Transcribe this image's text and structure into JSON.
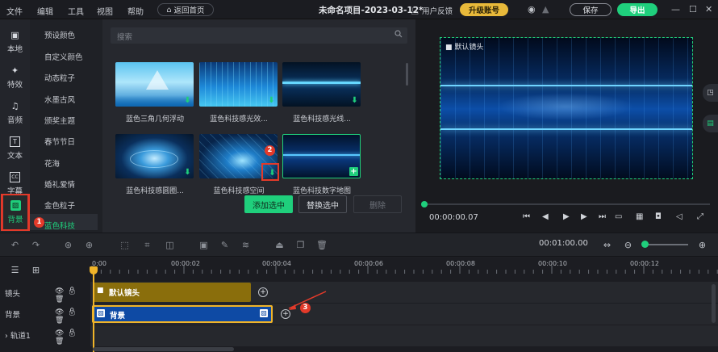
{
  "menu": [
    "文件",
    "编辑",
    "工具",
    "视图",
    "帮助"
  ],
  "home_button": "返回首页",
  "project_title": "未命名项目-2023-03-12*",
  "feedback": "用户反馈",
  "upgrade": "升级账号",
  "save": "保存",
  "export": "导出",
  "rail": [
    {
      "label": "本地",
      "icon": "folder-icon"
    },
    {
      "label": "特效",
      "icon": "effects-icon"
    },
    {
      "label": "音频",
      "icon": "music-icon"
    },
    {
      "label": "文本",
      "icon": "text-icon"
    },
    {
      "label": "字幕",
      "icon": "subtitle-icon"
    },
    {
      "label": "背景",
      "icon": "background-icon"
    }
  ],
  "categories": [
    "预设颜色",
    "自定义颜色",
    "动态粒子",
    "水墨古风",
    "颁奖主题",
    "春节节日",
    "花海",
    "婚礼爱情",
    "金色粒子",
    "蓝色科技"
  ],
  "search_placeholder": "搜索",
  "thumbnails": [
    {
      "label": "蓝色三角几何浮动"
    },
    {
      "label": "蓝色科技感光效..."
    },
    {
      "label": "蓝色科技感光线..."
    },
    {
      "label": "蓝色科技感圆圈..."
    },
    {
      "label": "蓝色科技感空间"
    },
    {
      "label": "蓝色科技数字地图"
    }
  ],
  "buttons": {
    "add": "添加选中",
    "replace": "替换选中",
    "delete": "删除"
  },
  "preview": {
    "label": "默认镜头",
    "timecode": "00:00:00.07",
    "progress": 0.0
  },
  "toolbar": {
    "duration": "00:01:00.00"
  },
  "ruler": [
    "0:00",
    "00:00:02",
    "00:00:04",
    "00:00:06",
    "00:00:08",
    "00:00:10",
    "00:00:12"
  ],
  "tracks": [
    {
      "name": "镜头",
      "clip": "默认镜头"
    },
    {
      "name": "背景",
      "clip": "背景"
    },
    {
      "name": "轨道1",
      "clip": ""
    }
  ],
  "annotations": [
    "1",
    "2",
    "3"
  ],
  "colors": {
    "accent": "#1fcf7c",
    "highlight": "#e33a2a",
    "playhead": "#f0b429"
  }
}
